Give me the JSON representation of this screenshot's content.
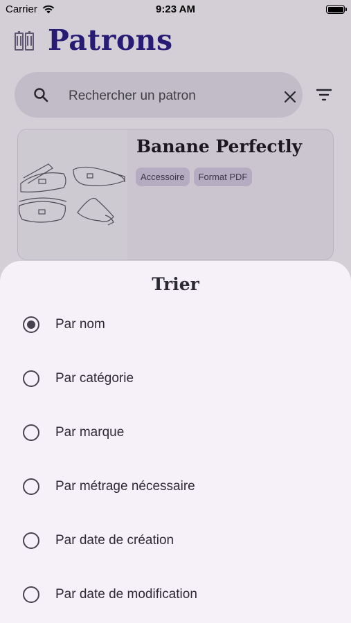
{
  "status_bar": {
    "carrier": "Carrier",
    "time": "9:23 AM"
  },
  "header": {
    "title": "Patrons",
    "logo_icon": "pattern-book-icon"
  },
  "search": {
    "placeholder": "Rechercher un patron",
    "search_icon": "search-icon",
    "clear_icon": "close-icon"
  },
  "filter": {
    "icon": "sort-filter-icon"
  },
  "cards": [
    {
      "title": "Banane Perfectly",
      "tags": [
        "Accessoire",
        "Format PDF"
      ],
      "image": "bag-pattern-sketch"
    }
  ],
  "sort_sheet": {
    "title": "Trier",
    "selected_index": 0,
    "options": [
      "Par nom",
      "Par catégorie",
      "Par marque",
      "Par métrage nécessaire",
      "Par date de création",
      "Par date de modification"
    ]
  },
  "colors": {
    "accent": "#2d1f82",
    "sheet_bg": "#f6f1f8",
    "chip_bg": "#cac0d8"
  }
}
